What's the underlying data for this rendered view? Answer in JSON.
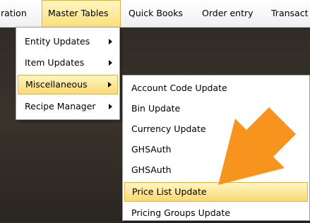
{
  "menubar": {
    "items": [
      {
        "label": "ration"
      },
      {
        "label": "Master Tables"
      },
      {
        "label": "Quick Books"
      },
      {
        "label": "Order entry"
      },
      {
        "label": "Transact"
      }
    ]
  },
  "master_tables_menu": {
    "items": [
      {
        "label": "Entity Updates"
      },
      {
        "label": "Item Updates"
      },
      {
        "label": "Miscellaneous"
      },
      {
        "label": "Recipe Manager"
      }
    ]
  },
  "miscellaneous_menu": {
    "items": [
      {
        "label": "Account Code Update"
      },
      {
        "label": "Bin Update"
      },
      {
        "label": "Currency Update"
      },
      {
        "label": "GHSAuth"
      },
      {
        "label": "GHSAuth"
      },
      {
        "label": "Price List Update"
      },
      {
        "label": "Pricing Groups Update"
      }
    ]
  },
  "annotation": {
    "arrow_color": "#f7941d",
    "icon": "arrow-icon"
  }
}
